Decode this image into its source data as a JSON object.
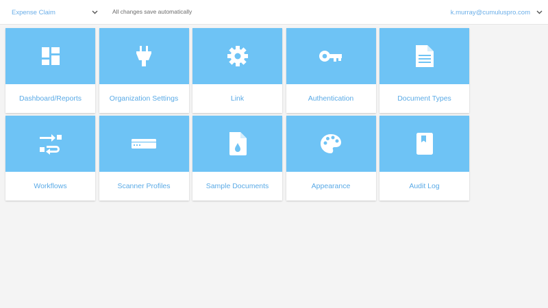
{
  "header": {
    "app_select_label": "Expense Claim",
    "save_status": "All changes save automatically",
    "user_email": "k.murray@cumuluspro.com"
  },
  "colors": {
    "tile_accent": "#6ec3f5",
    "link_text": "#5aaae6",
    "background": "#f4f4f4"
  },
  "tiles": [
    {
      "label": "Dashboard/Reports",
      "icon": "dashboard-icon"
    },
    {
      "label": "Organization Settings",
      "icon": "plug-icon"
    },
    {
      "label": "Link",
      "icon": "gear-icon"
    },
    {
      "label": "Authentication",
      "icon": "key-icon"
    },
    {
      "label": "Document Types",
      "icon": "document-icon"
    },
    {
      "label": "Workflows",
      "icon": "workflow-arrows-icon"
    },
    {
      "label": "Scanner Profiles",
      "icon": "scanner-icon"
    },
    {
      "label": "Sample Documents",
      "icon": "file-drop-icon"
    },
    {
      "label": "Appearance",
      "icon": "palette-icon"
    },
    {
      "label": "Audit Log",
      "icon": "book-bookmark-icon"
    }
  ]
}
